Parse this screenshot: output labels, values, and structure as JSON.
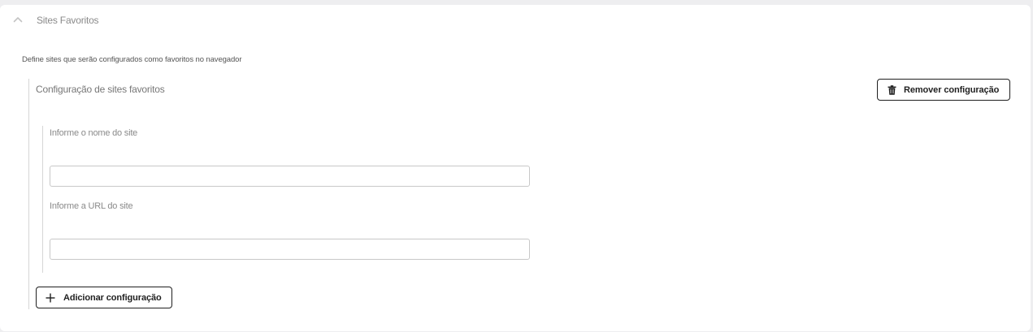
{
  "section": {
    "title": "Sites Favoritos",
    "expanded": true,
    "description": "Define sites que serão configurados como favoritos no navegador"
  },
  "config": {
    "title": "Configuração de sites favoritos",
    "remove_label": "Remover configuração",
    "add_label": "Adicionar configuração"
  },
  "fields": {
    "site_name": {
      "label": "Informe o nome do site",
      "value": "",
      "placeholder": ""
    },
    "site_url": {
      "label": "Informe a URL do site",
      "value": "",
      "placeholder": ""
    }
  },
  "icons": {
    "chevron": "chevron-up-icon",
    "remove": "trash-icon",
    "add": "plus-icon"
  },
  "colors": {
    "panel_bg": "#ffffff",
    "page_bg": "#eeeef0",
    "button_border": "#1f1f1f",
    "input_border": "#c8c8c8"
  }
}
